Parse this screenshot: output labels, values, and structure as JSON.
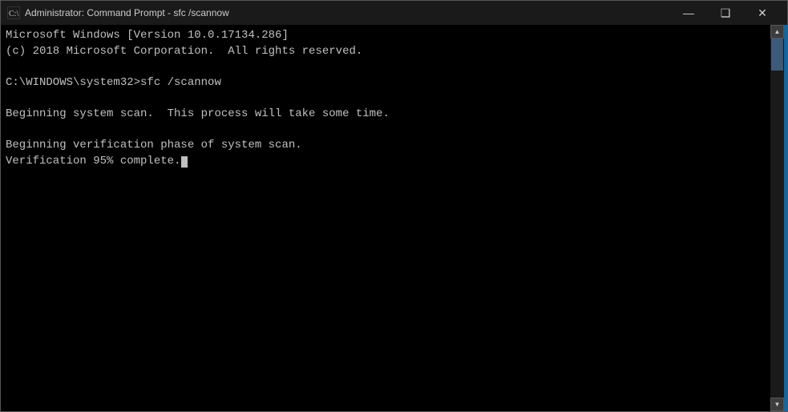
{
  "titleBar": {
    "icon": "▶",
    "title": "Administrator: Command Prompt - sfc /scannow",
    "minimizeLabel": "—",
    "restoreLabel": "❑",
    "closeLabel": "✕"
  },
  "terminal": {
    "lines": [
      "Microsoft Windows [Version 10.0.17134.286]",
      "(c) 2018 Microsoft Corporation.  All rights reserved.",
      "",
      "C:\\WINDOWS\\system32>sfc /scannow",
      "",
      "Beginning system scan.  This process will take some time.",
      "",
      "Beginning verification phase of system scan.",
      "Verification 95% complete."
    ]
  }
}
